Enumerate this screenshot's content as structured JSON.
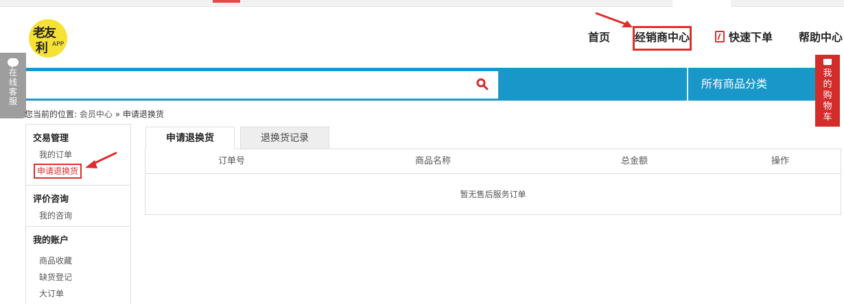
{
  "logo": {
    "line1": "老友",
    "line2": "利",
    "mark": "APP"
  },
  "nav": {
    "home": "首页",
    "dealer_center": "经销商中心",
    "quick_order": "快速下单",
    "help_center": "帮助中心"
  },
  "search": {
    "value": "",
    "placeholder": "",
    "icon": "search-icon"
  },
  "categories_label": "所有商品分类",
  "online_service": "在线客服",
  "cart_label": "我的购物车",
  "breadcrumb": {
    "prefix": "您当前的位置:",
    "link": "会员中心",
    "separator": "»",
    "current": "申请退换货"
  },
  "sidebar": {
    "sections": [
      {
        "title": "交易管理",
        "items": [
          "我的订单",
          "申请退换货"
        ]
      },
      {
        "title": "评价咨询",
        "items": [
          "我的咨询"
        ]
      },
      {
        "title": "我的账户",
        "items": [
          "商品收藏",
          "缺货登记",
          "大订单"
        ]
      }
    ]
  },
  "tabs": [
    "申请退换货",
    "退换货记录"
  ],
  "table": {
    "columns": [
      "订单号",
      "商品名称",
      "总金额",
      "操作"
    ],
    "empty_text": "暂无售后服务订单"
  },
  "colors": {
    "accent_blue": "#1a97c9",
    "highlight_red": "#e02b2b",
    "logo_yellow": "#f6e235"
  }
}
